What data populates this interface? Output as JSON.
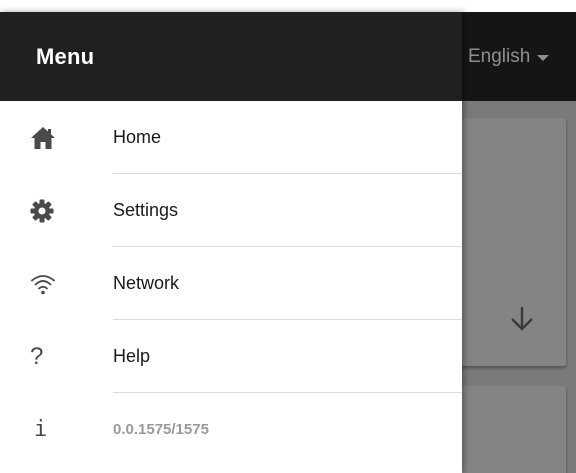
{
  "app_bar": {
    "language_selected": "English"
  },
  "drawer": {
    "title": "Menu",
    "items": [
      {
        "icon": "home-icon",
        "label": "Home"
      },
      {
        "icon": "gear-icon",
        "label": "Settings"
      },
      {
        "icon": "wifi-icon",
        "label": "Network"
      },
      {
        "icon": "question-icon",
        "label": "Help",
        "icon_glyph": "?"
      },
      {
        "icon": "info-icon",
        "label": "0.0.1575/1575",
        "icon_glyph": "i"
      }
    ]
  },
  "colors": {
    "drawer_header_bg": "#202020",
    "app_bar_bg": "#151515",
    "overlay_bg": "#7a7a7a",
    "drawer_bg": "#ffffff",
    "icon_color": "#4a4a4a"
  }
}
